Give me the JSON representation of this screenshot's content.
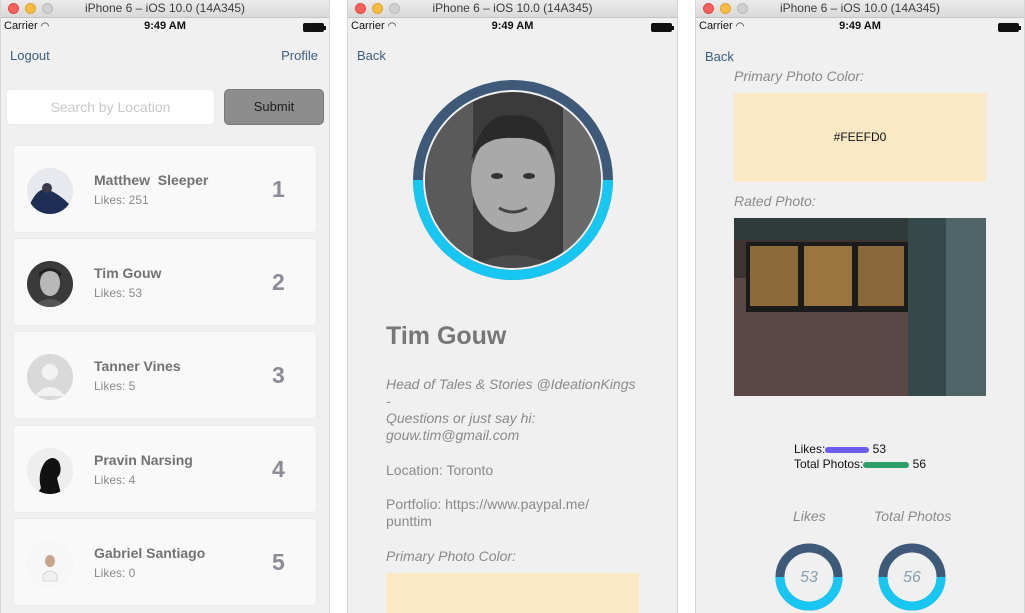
{
  "window_title": "iPhone 6 – iOS 10.0 (14A345)",
  "status": {
    "carrier": "Carrier",
    "time": "9:49 AM"
  },
  "screen1": {
    "logout": "Logout",
    "profile": "Profile",
    "search_placeholder": "Search by Location",
    "submit": "Submit",
    "users": [
      {
        "name": "Matthew  Sleeper",
        "likes": "Likes: 251",
        "rank": "1"
      },
      {
        "name": "Tim Gouw",
        "likes": "Likes: 53",
        "rank": "2"
      },
      {
        "name": "Tanner Vines",
        "likes": "Likes: 5",
        "rank": "3"
      },
      {
        "name": "Pravin Narsing",
        "likes": "Likes: 4",
        "rank": "4"
      },
      {
        "name": "Gabriel Santiago",
        "likes": "Likes: 0",
        "rank": "5"
      }
    ]
  },
  "screen2": {
    "back": "Back",
    "name": "Tim Gouw",
    "bio1": "Head of Tales & Stories @IdeationKings",
    "bio2": "-",
    "bio3": "Questions or just say hi:",
    "bio4": "gouw.tim@gmail.com",
    "location": "Location: Toronto",
    "portfolio1": "Portfolio: https://www.paypal.me/",
    "portfolio2": "punttim",
    "primary_color_label": "Primary Photo Color:",
    "primary_color": "#FEEFD0"
  },
  "screen3": {
    "back": "Back",
    "primary_color_label": "Primary Photo Color:",
    "primary_color_hex": "#FEEFD0",
    "rated_photo_label": "Rated Photo:",
    "likes_label": "Likes:",
    "likes_value": "53",
    "total_label": "Total Photos:",
    "total_value": "56",
    "ring_likes_label": "Likes",
    "ring_total_label": "Total Photos",
    "ring_likes_value": "53",
    "ring_total_value": "56",
    "likes_color": "#6a5cf0",
    "total_color": "#2e9e6a"
  }
}
